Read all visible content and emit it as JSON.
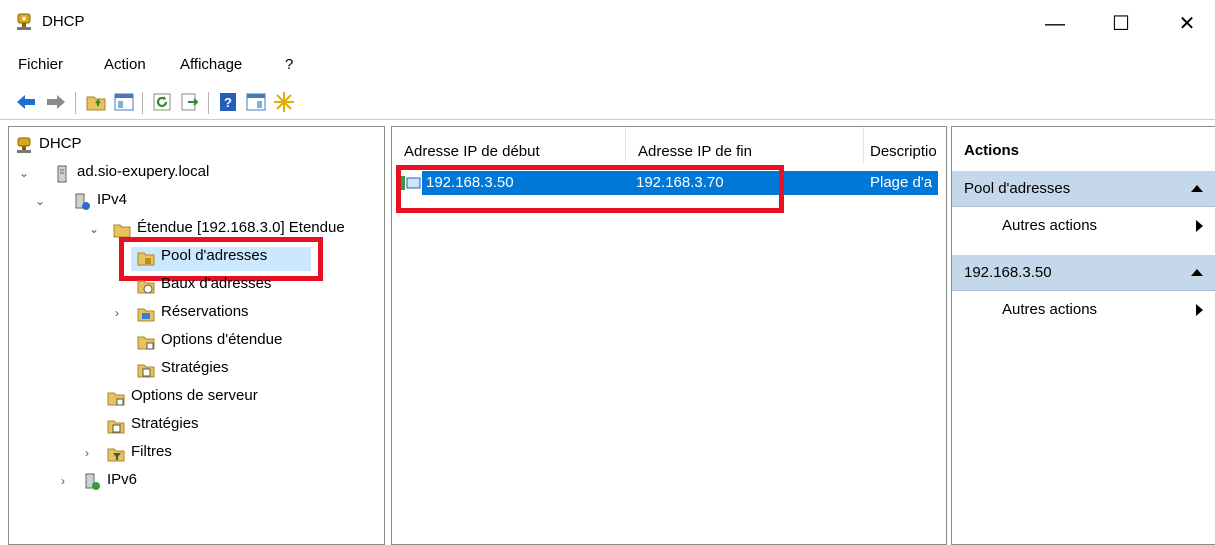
{
  "window": {
    "title": "DHCP",
    "minimize": "—",
    "maximize": "☐",
    "close": "✕"
  },
  "menu": [
    "Fichier",
    "Action",
    "Affichage",
    "?"
  ],
  "tree": {
    "root": "DHCP",
    "server": "ad.sio-exupery.local",
    "ipv4": "IPv4",
    "scope": "Étendue [192.168.3.0] Etendue",
    "pool": "Pool d'adresses",
    "leases": "Baux d'adresses",
    "reservations": "Réservations",
    "scope_options": "Options d'étendue",
    "scope_policies": "Stratégies",
    "server_options": "Options de serveur",
    "policies": "Stratégies",
    "filters": "Filtres",
    "ipv6": "IPv6"
  },
  "list": {
    "headers": [
      "Adresse IP de début",
      "Adresse IP de fin",
      "Descriptio"
    ],
    "rows": [
      {
        "start": "192.168.3.50",
        "end": "192.168.3.70",
        "description": "Plage d'a"
      }
    ]
  },
  "actions": {
    "title": "Actions",
    "sections": [
      {
        "heading": "Pool d'adresses",
        "item": "Autres actions"
      },
      {
        "heading": "192.168.3.50",
        "item": "Autres actions"
      }
    ]
  },
  "colors": {
    "selection": "#0078d7",
    "highlight_box": "#e81123",
    "actions_header": "#c5d7ea"
  }
}
